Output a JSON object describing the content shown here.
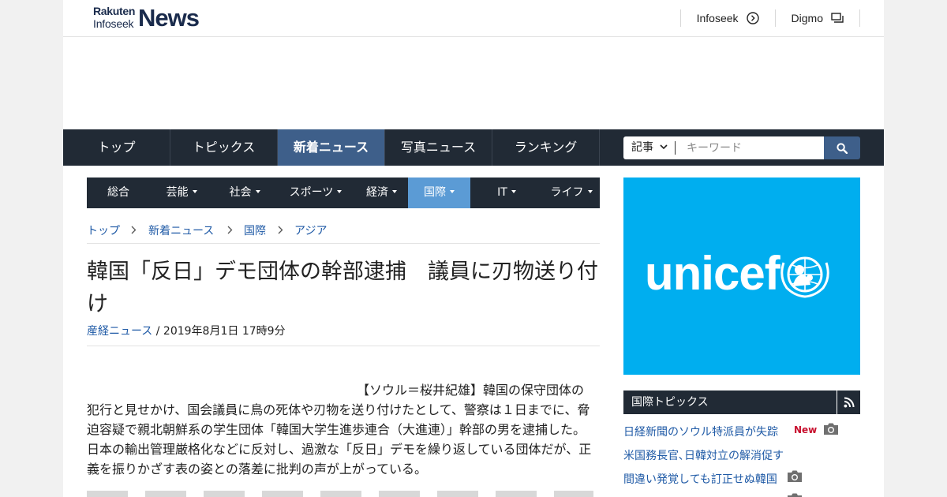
{
  "header": {
    "logo": {
      "line1": "Rakuten",
      "line2": "Infoseek",
      "line3": "News"
    },
    "links": [
      {
        "label": "Infoseek",
        "icon": "arrow-circle-right-icon"
      },
      {
        "label": "Digmo",
        "icon": "windows-icon"
      }
    ]
  },
  "main_nav": {
    "items": [
      {
        "label": "トップ"
      },
      {
        "label": "トピックス"
      },
      {
        "label": "新着ニュース",
        "active": true
      },
      {
        "label": "写真ニュース"
      },
      {
        "label": "ランキング"
      }
    ],
    "search": {
      "scope": "記事",
      "placeholder": "キーワード",
      "value": "",
      "button_icon": "search-icon"
    }
  },
  "category_nav": {
    "items": [
      {
        "label": "総合",
        "dropdown": false
      },
      {
        "label": "芸能",
        "dropdown": true
      },
      {
        "label": "社会",
        "dropdown": true
      },
      {
        "label": "スポーツ",
        "dropdown": true
      },
      {
        "label": "経済",
        "dropdown": true
      },
      {
        "label": "国際",
        "dropdown": true,
        "active": true
      },
      {
        "label": "IT",
        "dropdown": true
      },
      {
        "label": "ライフ",
        "dropdown": true
      }
    ]
  },
  "breadcrumb": [
    "トップ",
    "新着ニュース",
    "国際",
    "アジア"
  ],
  "article": {
    "title": "韓国「反日」デモ団体の幹部逮捕　議員に刃物送り付け",
    "source": "産経ニュース",
    "date": " / 2019年8月1日 17時9分",
    "paragraph": "【ソウル＝桜井紀雄】韓国の保守団体の犯行と見せかけ、国会議員に鳥の死体や刃物を送り付けたとして、警察は１日までに、脅迫容疑で親北朝鮮系の学生団体「韓国大学生進歩連合（大進連）」幹部の男を逮捕した。日本の輸出管理厳格化などに反対し、過激な「反日」デモを繰り返している団体だが、正義を振りかざす表の姿との落差に批判の声が上がっている。"
  },
  "sidebar": {
    "ad": {
      "text": "unicef",
      "color": "#00aeef"
    },
    "topics": {
      "heading": "国際トピックス",
      "rss_icon": "rss-icon",
      "items": [
        {
          "title": "日経新聞のソウル特派員が失踪",
          "badge": "New",
          "photo": true
        },
        {
          "title": "米国務長官､日韓対立の解消促す",
          "badge": "",
          "photo": false
        },
        {
          "title": "間違い発覚しても訂正せぬ韓国",
          "badge": "",
          "photo": true
        }
      ]
    }
  },
  "colors": {
    "nav_dark": "#212a35",
    "nav_active": "#3e5f8a",
    "category_active": "#5b9bd5",
    "link": "#1f5aa6",
    "new_badge": "#c8102e"
  }
}
